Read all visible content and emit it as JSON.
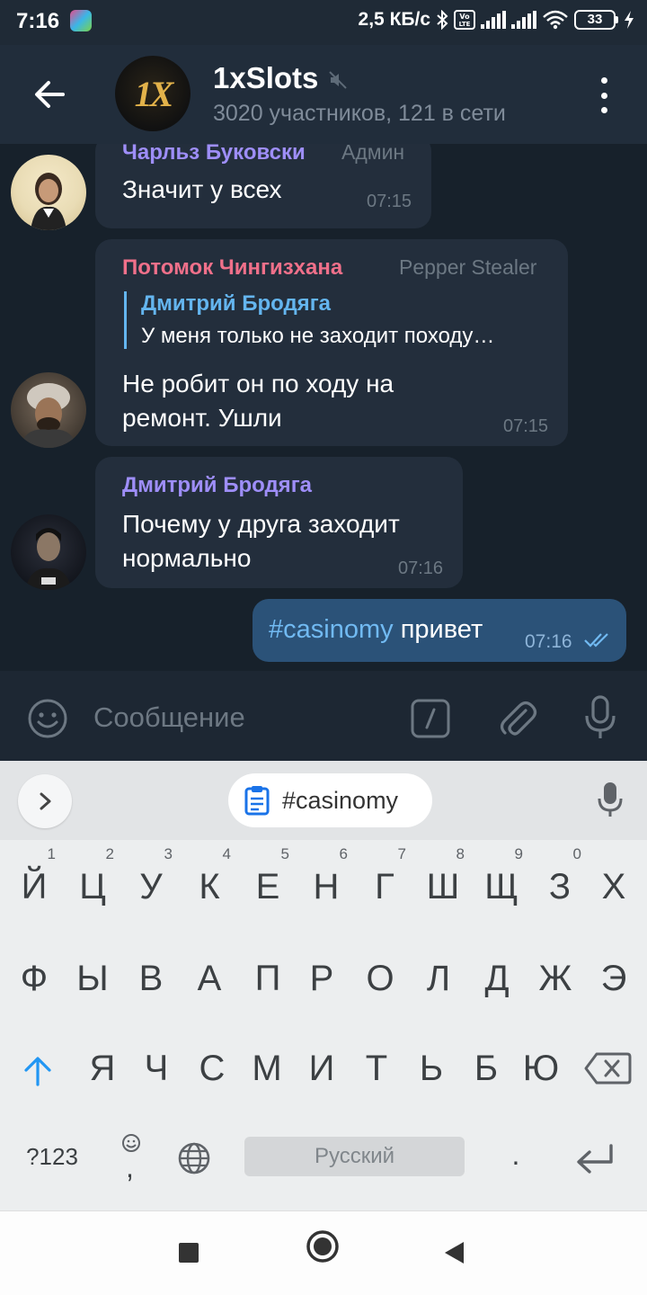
{
  "status_bar": {
    "time": "7:16",
    "network_speed": "2,5 КБ/с",
    "battery_level": "33"
  },
  "header": {
    "title": "1xSlots",
    "avatar_text": "1X",
    "subtitle": "3020 участников, 121 в сети"
  },
  "messages": [
    {
      "sender": "Чарльз Буковски",
      "sender_color": "#9e8ef8",
      "role": "Админ",
      "text": "Значит у всех",
      "time": "07:15"
    },
    {
      "sender": "Потомок Чингизхана",
      "sender_color": "#f0708a",
      "role": "Pepper Stealer",
      "reply": {
        "name": "Дмитрий Бродяга",
        "text": "У меня только не заходит походу…"
      },
      "text_lines": [
        "Не робит он по ходу на",
        "ремонт. Ушли"
      ],
      "time": "07:15"
    },
    {
      "sender": "Дмитрий Бродяга",
      "sender_color": "#9e8ef8",
      "text_lines": [
        "Почему у друга заходит",
        "нормально"
      ],
      "time": "07:16"
    }
  ],
  "outgoing": {
    "hashtag": "#casinomy",
    "text": "привет",
    "time": "07:16"
  },
  "composer": {
    "placeholder": "Сообщение"
  },
  "keyboard": {
    "clipboard_chip": "#casinomy",
    "row1": [
      {
        "key": "Й",
        "hint": "1"
      },
      {
        "key": "Ц",
        "hint": "2"
      },
      {
        "key": "У",
        "hint": "3"
      },
      {
        "key": "К",
        "hint": "4"
      },
      {
        "key": "Е",
        "hint": "5"
      },
      {
        "key": "Н",
        "hint": "6"
      },
      {
        "key": "Г",
        "hint": "7"
      },
      {
        "key": "Ш",
        "hint": "8"
      },
      {
        "key": "Щ",
        "hint": "9"
      },
      {
        "key": "З",
        "hint": "0"
      },
      {
        "key": "Х",
        "hint": ""
      }
    ],
    "row2": [
      "Ф",
      "Ы",
      "В",
      "А",
      "П",
      "Р",
      "О",
      "Л",
      "Д",
      "Ж",
      "Э"
    ],
    "row3": [
      "Я",
      "Ч",
      "С",
      "М",
      "И",
      "Т",
      "Ь",
      "Б",
      "Ю"
    ],
    "symbols_key": "?123",
    "comma_key": ",",
    "space_label": "Русский",
    "period_key": "."
  },
  "colors": {
    "chat_bg": "#17212b",
    "incoming_bubble": "#232e3c",
    "outgoing_bubble": "#2b5278",
    "link_blue": "#64b5ef",
    "accent_keyboard": "#2196f3"
  }
}
